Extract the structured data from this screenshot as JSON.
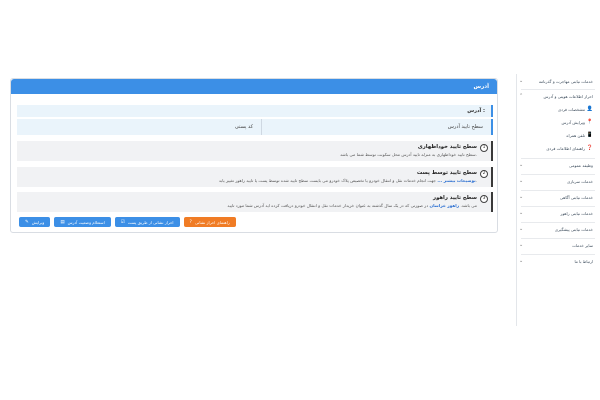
{
  "card": {
    "title": "آدرس",
    "address_label": "آدرس :",
    "verify_label": "سطح تایید آدرس",
    "postal_label": "کد پستی",
    "levels": [
      {
        "num": "1",
        "title": "سطح تایید خوداظهاری",
        "desc": "سطح تایید خوداظهاری به منزله تایید آدرس محل سکونت توسط شما می باشد."
      },
      {
        "num": "2",
        "title": "سطح تایید توسط پست",
        "desc": "جهت انجام خدمات نقل و انتقال خودرو یا تخصیص پلاک خودرو می بایست سطح تایید شده توسط پست یا تایید راهور تغییر یابد.",
        "more": "توضیحات بیشتر ..."
      },
      {
        "num": "3",
        "title": "سطح تایید راهور",
        "desc": "در صورتی که در یک سال گذشته به عنوان خریدار خدمات نقل و انتقال خودرو دریافت کرده اید آدرس شما مورد تایید",
        "more": "راهور خراسان",
        "desc_end": "می باشد."
      }
    ],
    "buttons": {
      "edit": "ویرایش",
      "status": "استعلام وضعیت آدرس",
      "post_verify": "احراز نشانی از طریق پست",
      "guide": "راهنمای احراز نشانی"
    }
  },
  "sidebar": {
    "items": [
      {
        "label": "خدمات نیابتی مهاجرت و گذرنامه",
        "chev": "⌄"
      },
      {
        "label": "احراز اطلاعات هویتی و آدرس",
        "chev": "⌃"
      },
      {
        "label": "مشخصات فردی",
        "icon": "👤"
      },
      {
        "label": "ویرایش آدرس",
        "icon": "📍"
      },
      {
        "label": "تلفن همراه",
        "icon": "📱"
      },
      {
        "label": "راهنمای اطلاعات فردی",
        "icon": "❓"
      },
      {
        "label": "وظیفه عمومی",
        "chev": "⌄"
      },
      {
        "label": "خدمات سربازی",
        "chev": "⌄"
      },
      {
        "label": "خدمات نیابتی آگاهی",
        "chev": "⌄"
      },
      {
        "label": "خدمات نیابتی راهور",
        "chev": "⌄"
      },
      {
        "label": "خدمات نیابتی پیشگیری",
        "chev": "⌄"
      },
      {
        "label": "سایر خدمات",
        "chev": "⌄"
      },
      {
        "label": "ارتباط با ما",
        "chev": "⌄"
      }
    ]
  }
}
